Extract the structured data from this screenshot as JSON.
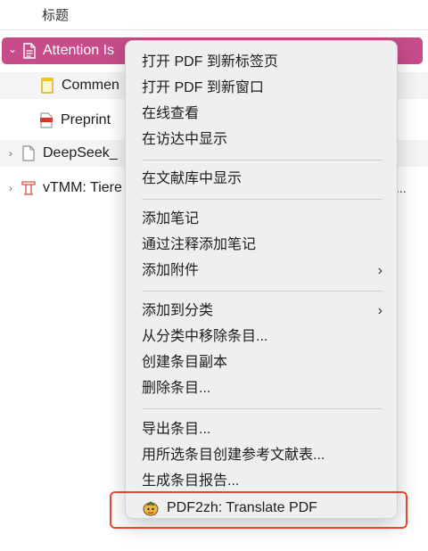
{
  "list": {
    "column_header": "标题",
    "rows": [
      {
        "twisty": "⌄",
        "title": "Attention Is",
        "icon": "document-icon"
      },
      {
        "twisty": "",
        "title": "Commen",
        "icon": "note-icon"
      },
      {
        "twisty": "",
        "title": "Preprint",
        "icon": "pdf-icon"
      },
      {
        "twisty": "›",
        "title": "DeepSeek_",
        "icon": "document-icon"
      },
      {
        "twisty": "›",
        "title": "vTMM: Tiere",
        "icon": "lectern-icon",
        "trailing": "..."
      }
    ]
  },
  "menu": {
    "open_new_tab": "打开 PDF 到新标签页",
    "open_new_window": "打开 PDF 到新窗口",
    "view_online": "在线查看",
    "show_in_finder": "在访达中显示",
    "show_in_library": "在文献库中显示",
    "add_note": "添加笔记",
    "add_note_from_annotations": "通过注释添加笔记",
    "add_attachment": "添加附件",
    "add_to_collection": "添加到分类",
    "remove_from_collection": "从分类中移除条目...",
    "duplicate_item": "创建条目副本",
    "delete_item": "删除条目...",
    "export_item": "导出条目...",
    "create_bibliography": "用所选条目创建参考文献表...",
    "generate_report": "生成条目报告...",
    "translate_pdf": "PDF2zh: Translate PDF",
    "submenu_chevron": "›"
  },
  "colors": {
    "selection": "#c64c8a",
    "highlight_border": "#e8452f",
    "menu_bg": "#efefef"
  }
}
